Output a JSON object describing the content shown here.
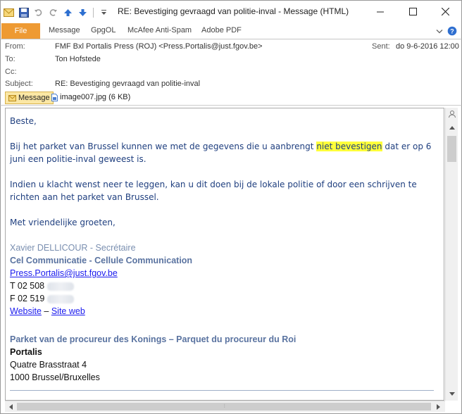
{
  "window": {
    "title": "RE: Bevestiging gevraagd van politie-inval  -  Message (HTML)"
  },
  "ribbon": {
    "tabs": [
      "File",
      "Message",
      "GpgOL",
      "McAfee Anti-Spam",
      "Adobe PDF"
    ]
  },
  "headers": {
    "from_label": "From:",
    "from_value": "FMF Bxl Portalis Press (ROJ) <Press.Portalis@just.fgov.be>",
    "to_label": "To:",
    "to_value": "Ton Hofstede",
    "cc_label": "Cc:",
    "cc_value": "",
    "subject_label": "Subject:",
    "subject_value": "RE: Bevestiging gevraagd van politie-inval",
    "sent_label": "Sent:",
    "sent_value": "do 9-6-2016 12:00"
  },
  "attachments": {
    "message_tab": "Message",
    "file": "image007.jpg (6 KB)"
  },
  "body": {
    "greeting": "Beste,",
    "p1_before": "Bij het parket van Brussel kunnen we met de gegevens die u aanbrengt ",
    "p1_highlight": "niet bevestigen",
    "p1_after": " dat er op 6 juni een politie-inval geweest is.",
    "p2": "Indien u klacht wenst neer te leggen, kan u dit doen bij de lokale politie of door een schrijven te richten aan het parket van Brussel.",
    "closing": "Met vriendelijke groeten,",
    "sig_name": "Xavier DELLICOUR - Secrétaire",
    "sig_dept": "Cel Communicatie - Cellule Communication",
    "sig_email": "Press.Portalis@just.fgov.be",
    "sig_tel": "T 02 508",
    "sig_fax": "F 02 519",
    "sig_website": "Website",
    "sig_dash": " – ",
    "sig_siteweb": "Site web",
    "parket": "Parket van de procureur des Konings – Parquet du procureur du Roi",
    "org": "Portalis",
    "street": "Quatre Brasstraat 4",
    "city": "1000 Brussel/Bruxelles"
  },
  "colors": {
    "file_tab": "#ee9a33",
    "highlight": "#ffff3a",
    "body_text": "#1f3f7f"
  }
}
